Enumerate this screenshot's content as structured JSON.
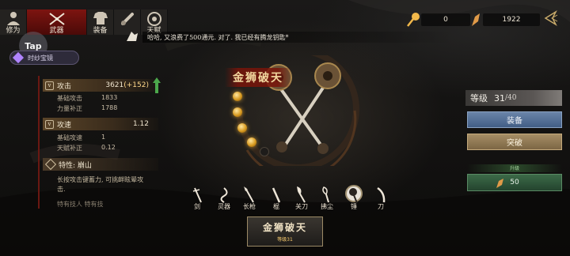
{
  "tabs": [
    {
      "label": "修为",
      "icon": "person-icon",
      "active": false
    },
    {
      "label": "武器",
      "icon": "crossed-swords-icon",
      "active": true
    },
    {
      "label": "装备",
      "icon": "armor-icon",
      "active": false
    },
    {
      "label": "",
      "icon": "scroll-icon",
      "active": false
    },
    {
      "label": "天赋",
      "icon": "talent-icon",
      "active": false
    }
  ],
  "ad_badge": "Tap",
  "gem_button": {
    "label": "时纱宝镜",
    "icon": "gem-icon"
  },
  "currency": {
    "keys": {
      "icon": "key-icon",
      "value": "0"
    },
    "crystals": {
      "icon": "crystal-icon",
      "value": "1922"
    }
  },
  "chat": {
    "text": "哈哈, 又浪费了500通元. 对了. 我已经有腾龙钥匙*"
  },
  "stats": {
    "attack": {
      "label": "攻击",
      "value": "3621",
      "bonus": "(+152)",
      "subs": [
        {
          "label": "基础攻击",
          "value": "1833"
        },
        {
          "label": "力量补正",
          "value": "1788"
        }
      ]
    },
    "speed": {
      "label": "攻速",
      "value": "1.12",
      "subs": [
        {
          "label": "基础攻速",
          "value": "1"
        },
        {
          "label": "天赋补正",
          "value": "0.12"
        }
      ]
    },
    "trait": {
      "label": "特性: 崩山",
      "desc": "长按攻击键蓄力, 可挑衅眩晕攻击.",
      "cutoff": "特有技人 特有技"
    }
  },
  "weapon": {
    "name": "金狮破天",
    "orbs_filled": 4,
    "orbs_total": 5
  },
  "weapon_types": [
    {
      "label": "剑",
      "icon": "sword-icon",
      "selected": false
    },
    {
      "label": "灵器",
      "icon": "spirit-weapon-icon",
      "selected": false
    },
    {
      "label": "长枪",
      "icon": "spear-icon",
      "selected": false
    },
    {
      "label": "棍",
      "icon": "staff-icon",
      "selected": false
    },
    {
      "label": "关刀",
      "icon": "guan-dao-icon",
      "selected": false
    },
    {
      "label": "拂尘",
      "icon": "whisk-icon",
      "selected": false
    },
    {
      "label": "锤",
      "icon": "hammer-icon",
      "selected": true
    },
    {
      "label": "刀",
      "icon": "saber-icon",
      "selected": false
    }
  ],
  "bottom_card": {
    "name": "金狮破天",
    "level": "等级31"
  },
  "right_panel": {
    "level_label": "等级",
    "level": "31",
    "level_max": "/40",
    "equip_label": "装备",
    "break_label": "突破",
    "upgrade_label": "升级",
    "upgrade_cost": "50",
    "upgrade_icon": "crystal-icon"
  },
  "colors": {
    "accent_red": "#7d1410",
    "equip_blue": "#425e86",
    "break_gold": "#7c6644",
    "upgrade_green": "#24442e"
  }
}
